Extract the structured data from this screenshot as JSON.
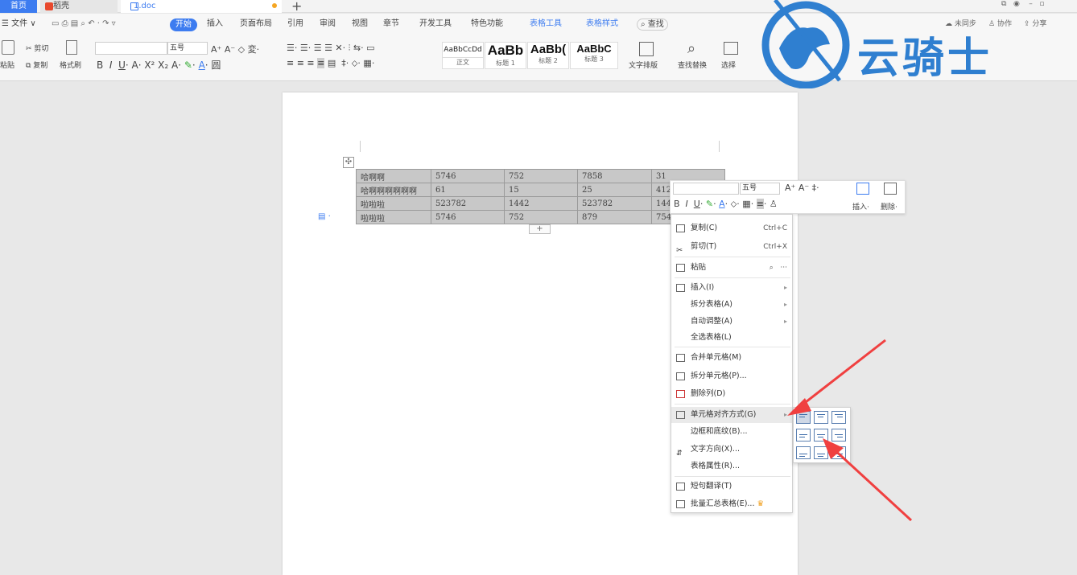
{
  "tabs": {
    "home": "首页",
    "daoke": "稻壳",
    "doc": "1.doc"
  },
  "menu": {
    "file": "文件",
    "start": "开始",
    "items": [
      "插入",
      "页面布局",
      "引用",
      "审阅",
      "视图",
      "章节",
      "开发工具",
      "特色功能"
    ],
    "table_tools": "表格工具",
    "table_style": "表格样式",
    "search": "查找",
    "sync": "未同步",
    "collab": "协作",
    "share": "分享"
  },
  "ribbon": {
    "cut": "剪切",
    "paste": "粘贴",
    "copy": "复制",
    "format_painter": "格式刷",
    "font_size": "五号",
    "styles": [
      {
        "preview": "AaBbCcDd",
        "label": "正文"
      },
      {
        "preview": "AaBb",
        "label": "标题 1"
      },
      {
        "preview": "AaBb(",
        "label": "标题 2"
      },
      {
        "preview": "AaBbC",
        "label": "标题 3"
      }
    ],
    "text_layout": "文字排版",
    "find_replace": "查找替换",
    "select": "选择"
  },
  "watermark": {
    "text": "云骑士"
  },
  "table": {
    "rows": [
      [
        "哈啊啊",
        "5746",
        "752",
        "7858",
        "31"
      ],
      [
        "哈啊啊啊啊啊啊",
        "61",
        "15",
        "25",
        "412"
      ],
      [
        "啦啦啦",
        "523782",
        "1442",
        "523782",
        "144"
      ],
      [
        "啦啦啦",
        "5746",
        "752",
        "879",
        "754"
      ]
    ],
    "add_button": "+"
  },
  "mini_toolbar": {
    "font_size": "五号",
    "insert": "插入",
    "delete": "删除"
  },
  "context_menu": {
    "copy": "复制(C)",
    "copy_shortcut": "Ctrl+C",
    "cut": "剪切(T)",
    "cut_shortcut": "Ctrl+X",
    "paste": "粘贴",
    "insert": "插入(I)",
    "split_table": "拆分表格(A)",
    "auto_fit": "自动调整(A)",
    "select_table": "全选表格(L)",
    "merge_cells": "合并单元格(M)",
    "split_cells": "拆分单元格(P)...",
    "delete_column": "删除列(D)",
    "cell_align": "单元格对齐方式(G)",
    "borders": "边框和底纹(B)...",
    "text_direction": "文字方向(X)...",
    "table_props": "表格属性(R)...",
    "translate": "短句翻译(T)",
    "batch_sum": "批量汇总表格(E)..."
  },
  "colors": {
    "accent": "#3d7cf0",
    "arrow": "#f04040",
    "watermark": "#2f7fd0"
  }
}
